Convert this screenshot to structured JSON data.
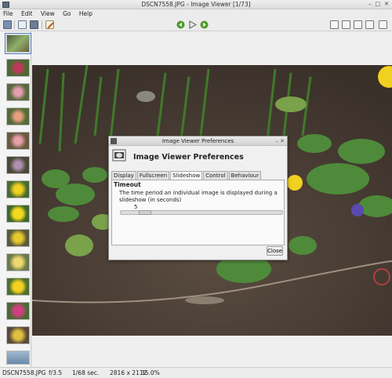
{
  "window": {
    "title": "DSCN7558.JPG - Image Viewer [1/73]"
  },
  "menu": [
    "File",
    "Edit",
    "View",
    "Go",
    "Help"
  ],
  "toolbar": {
    "icons": [
      "open-folder-icon",
      "save-icon",
      "copy-icon",
      "edit-icon",
      "previous-icon",
      "play-slideshow-icon",
      "next-icon",
      "zoom-in-icon",
      "zoom-out-icon",
      "zoom-fit-icon",
      "zoom-100-icon",
      "fullscreen-icon"
    ]
  },
  "dialog": {
    "window_title": "Image Viewer Preferences",
    "header": "Image Viewer Preferences",
    "tabs": [
      "Display",
      "Fullscreen",
      "Slideshow",
      "Control",
      "Behaviour"
    ],
    "active_tab": "Slideshow",
    "section_title": "Timeout",
    "description": "The time period an individual image is displayed during a slideshow (in seconds)",
    "slider_value": "5",
    "slider_fraction": 0.06,
    "close_label": "Close"
  },
  "status": {
    "filename": "DSCN7558.JPG",
    "aperture": "f/3.5",
    "exposure": "1/68 sec.",
    "dimensions": "2816 x 2112",
    "zoom": "35.0%"
  },
  "colors": {
    "accent": "#4a7ab5",
    "photo_soil": "#4a3f36"
  }
}
